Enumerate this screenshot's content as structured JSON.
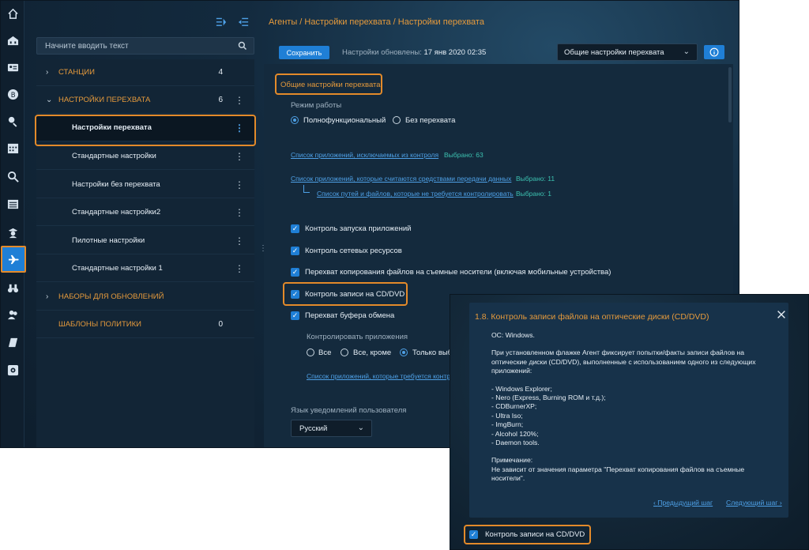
{
  "breadcrumb": "Агенты / Настройки перехвата / Настройки перехвата",
  "search": {
    "placeholder": "Начните вводить текст"
  },
  "tree": {
    "groups": [
      {
        "label": "СТАНЦИИ",
        "count": "4"
      },
      {
        "label": "НАСТРОЙКИ ПЕРЕХВАТА",
        "count": "6"
      },
      {
        "label": "НАБОРЫ ДЛЯ ОБНОВЛЕНИЙ",
        "count": ""
      },
      {
        "label": "ШАБЛОНЫ ПОЛИТИКИ",
        "count": "0"
      }
    ],
    "items": [
      "Настройки перехвата",
      "Стандартные настройки",
      "Настройки без перехвата",
      "Стандартные настройки2",
      "Пилотные настройки",
      "Стандартные настройки 1"
    ]
  },
  "toolbar": {
    "save_label": "Сохранить",
    "updated_label": "Настройки обновлены:",
    "updated_value": "17 янв 2020 02:35",
    "section_select": "Общие настройки перехвата"
  },
  "form": {
    "section_title": "Общие настройки перехвата",
    "mode_label": "Режим работы",
    "mode_options": [
      "Полнофункциональный",
      "Без перехвата"
    ],
    "links": [
      {
        "text": "Список приложений, исключаемых из контроля",
        "selected": "Выбрано: 63"
      },
      {
        "text": "Список приложений, которые считаются средствами передачи данных",
        "selected": "Выбрано: 11"
      },
      {
        "text": "Список путей и файлов, которые не требуется контролировать",
        "selected": "Выбрано: 1"
      }
    ],
    "checkboxes": [
      "Контроль запуска приложений",
      "Контроль сетевых ресурсов",
      "Перехват копирования файлов на съемные носители (включая мобильные устройства)",
      "Контроль записи на CD/DVD",
      "Перехват буфера обмена"
    ],
    "apps_label": "Контролировать приложения",
    "apps_options": [
      "Все",
      "Все, кроме",
      "Только выбр"
    ],
    "apps_link": "Список приложений, которые требуется контр",
    "lang_label": "Язык уведомлений пользователя",
    "lang_value": "Русский"
  },
  "help": {
    "title": "1.8. Контроль записи файлов на оптические диски (CD/DVD)",
    "os": "ОС: Windows.",
    "intro": "При установленном флажке Агент фиксирует попытки/факты записи файлов на оптические диски (CD/DVD), выполненные с использованием одного из следующих приложений:",
    "apps": [
      "- Windows Explorer;",
      "- Nero (Express, Burning ROM и т.д.);",
      "- CDBurnerXP;",
      "- Ultra Iso;",
      "- ImgBurn;",
      "- Alcohol 120%;",
      "- Daemon tools."
    ],
    "note_title": "Примечание:",
    "note_text": "Не зависит от значения параметра \"Перехват копирования файлов на съемные носители\".",
    "prev": "Предыдущий шаг",
    "next": "Следующий шаг",
    "checkbox_label": "Контроль записи на CD/DVD"
  }
}
